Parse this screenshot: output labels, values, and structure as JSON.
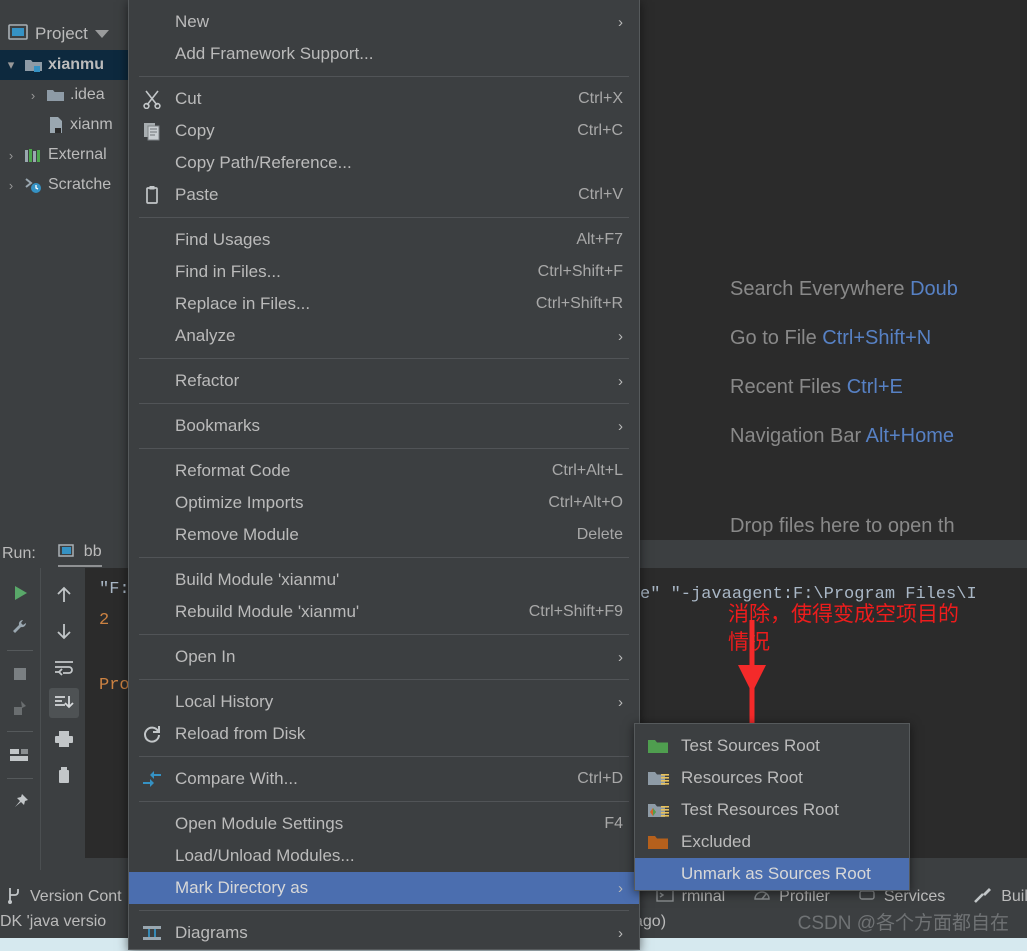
{
  "project_panel": {
    "title": "Project",
    "tree": [
      {
        "label": "xianmu",
        "icon": "module-folder-icon",
        "twisty": "v",
        "selected": true,
        "indent": 1,
        "bold": true
      },
      {
        "label": ".idea",
        "icon": "folder-icon",
        "twisty": ">",
        "selected": false,
        "indent": 2,
        "bold": false
      },
      {
        "label": "xianm",
        "icon": "iml-file-icon",
        "twisty": "",
        "selected": false,
        "indent": 3,
        "bold": false
      },
      {
        "label": "External",
        "icon": "libraries-icon",
        "twisty": ">",
        "selected": false,
        "indent": 1,
        "bold": false
      },
      {
        "label": "Scratche",
        "icon": "scratches-icon",
        "twisty": ">",
        "selected": false,
        "indent": 1,
        "bold": false
      }
    ]
  },
  "editor_hints": {
    "lines": [
      {
        "text": "Search Everywhere",
        "key": "Doub"
      },
      {
        "text": "Go to File",
        "key": "Ctrl+Shift+N"
      },
      {
        "text": "Recent Files",
        "key": "Ctrl+E"
      },
      {
        "text": "Navigation Bar",
        "key": "Alt+Home"
      }
    ],
    "drop_text": "Drop files here to open th"
  },
  "context_menu": {
    "items": [
      {
        "label": "New",
        "accel": "",
        "arrow": true,
        "icon": "",
        "underline": ""
      },
      {
        "label": "Add Framework Support...",
        "accel": "",
        "arrow": false,
        "icon": "",
        "underline": ""
      },
      {
        "sep": true
      },
      {
        "label": "Cut",
        "accel": "Ctrl+X",
        "arrow": false,
        "icon": "scissors-icon",
        "underline": "t"
      },
      {
        "label": "Copy",
        "accel": "Ctrl+C",
        "arrow": false,
        "icon": "copy-icon",
        "underline": "C"
      },
      {
        "label": "Copy Path/Reference...",
        "accel": "",
        "arrow": false,
        "icon": "",
        "underline": ""
      },
      {
        "label": "Paste",
        "accel": "Ctrl+V",
        "arrow": false,
        "icon": "clipboard-icon",
        "underline": "P"
      },
      {
        "sep": true
      },
      {
        "label": "Find Usages",
        "accel": "Alt+F7",
        "arrow": false,
        "icon": "",
        "underline": "U"
      },
      {
        "label": "Find in Files...",
        "accel": "Ctrl+Shift+F",
        "arrow": false,
        "icon": "",
        "underline": ""
      },
      {
        "label": "Replace in Files...",
        "accel": "Ctrl+Shift+R",
        "arrow": false,
        "icon": "",
        "underline": "a"
      },
      {
        "label": "Analyze",
        "accel": "",
        "arrow": true,
        "icon": "",
        "underline": "z"
      },
      {
        "sep": true
      },
      {
        "label": "Refactor",
        "accel": "",
        "arrow": true,
        "icon": "",
        "underline": "R"
      },
      {
        "sep": true
      },
      {
        "label": "Bookmarks",
        "accel": "",
        "arrow": true,
        "icon": "",
        "underline": ""
      },
      {
        "sep": true
      },
      {
        "label": "Reformat Code",
        "accel": "Ctrl+Alt+L",
        "arrow": false,
        "icon": "",
        "underline": "R"
      },
      {
        "label": "Optimize Imports",
        "accel": "Ctrl+Alt+O",
        "arrow": false,
        "icon": "",
        "underline": "z"
      },
      {
        "label": "Remove Module",
        "accel": "Delete",
        "arrow": false,
        "icon": "",
        "underline": ""
      },
      {
        "sep": true
      },
      {
        "label": "Build Module 'xianmu'",
        "accel": "",
        "arrow": false,
        "icon": "",
        "underline": "M"
      },
      {
        "label": "Rebuild Module 'xianmu'",
        "accel": "Ctrl+Shift+F9",
        "arrow": false,
        "icon": "",
        "underline": "e"
      },
      {
        "sep": true
      },
      {
        "label": "Open In",
        "accel": "",
        "arrow": true,
        "icon": "",
        "underline": ""
      },
      {
        "sep": true
      },
      {
        "label": "Local History",
        "accel": "",
        "arrow": true,
        "icon": "",
        "underline": "H"
      },
      {
        "label": "Reload from Disk",
        "accel": "",
        "arrow": false,
        "icon": "refresh-icon",
        "underline": ""
      },
      {
        "sep": true
      },
      {
        "label": "Compare With...",
        "accel": "Ctrl+D",
        "arrow": false,
        "icon": "compare-icon",
        "underline": ""
      },
      {
        "sep": true
      },
      {
        "label": "Open Module Settings",
        "accel": "F4",
        "arrow": false,
        "icon": "",
        "underline": ""
      },
      {
        "label": "Load/Unload Modules...",
        "accel": "",
        "arrow": false,
        "icon": "",
        "underline": ""
      },
      {
        "label": "Mark Directory as",
        "accel": "",
        "arrow": true,
        "icon": "",
        "underline": "",
        "selected": true
      },
      {
        "sep": true
      },
      {
        "label": "Diagrams",
        "accel": "",
        "arrow": true,
        "icon": "diagrams-icon",
        "underline": ""
      }
    ]
  },
  "submenu": {
    "items": [
      {
        "label": "Test Sources Root",
        "icon": "green-folder-icon",
        "selected": false
      },
      {
        "label": "Resources Root",
        "icon": "resources-folder-icon",
        "selected": false
      },
      {
        "label": "Test Resources Root",
        "icon": "test-resources-folder-icon",
        "selected": false
      },
      {
        "label": "Excluded",
        "icon": "orange-folder-icon",
        "selected": false
      },
      {
        "label": "Unmark as Sources Root",
        "icon": "",
        "selected": true
      }
    ]
  },
  "run_window": {
    "label": "Run:",
    "tab_name": "bb",
    "console_lines": [
      {
        "text": "\"F:",
        "color": "normal"
      },
      {
        "text": "2",
        "color": "orange"
      },
      {
        "text": "",
        "color": "normal"
      },
      {
        "text": "Pro",
        "color": "orange"
      }
    ],
    "code_line": "e\" \"-javaagent:F:\\Program Files\\I"
  },
  "bottom_tabs": [
    {
      "label": "Version Cont",
      "icon": "vcs-branch-icon"
    },
    {
      "label": "rminal",
      "icon": "terminal-icon"
    },
    {
      "label": "Profiler",
      "icon": "profiler-icon"
    },
    {
      "label": "Services",
      "icon": "services-icon"
    },
    {
      "label": "Build",
      "icon": "hammer-icon"
    }
  ],
  "status_bar": {
    "left_text": "DK 'java versio",
    "right_text": "tes ago)"
  },
  "annotation": {
    "text": "消除，使得变成空项目的情况",
    "color": "#ee1c1c"
  },
  "watermark": "CSDN @各个方面都自在",
  "colors": {
    "menu_bg": "#3c3f41",
    "editor_bg": "#2b2b2b",
    "highlight": "#4b6eaf",
    "tree_selected": "#0d293e",
    "hint_key": "#5781c4",
    "annotation_red": "#ee1c1c"
  }
}
